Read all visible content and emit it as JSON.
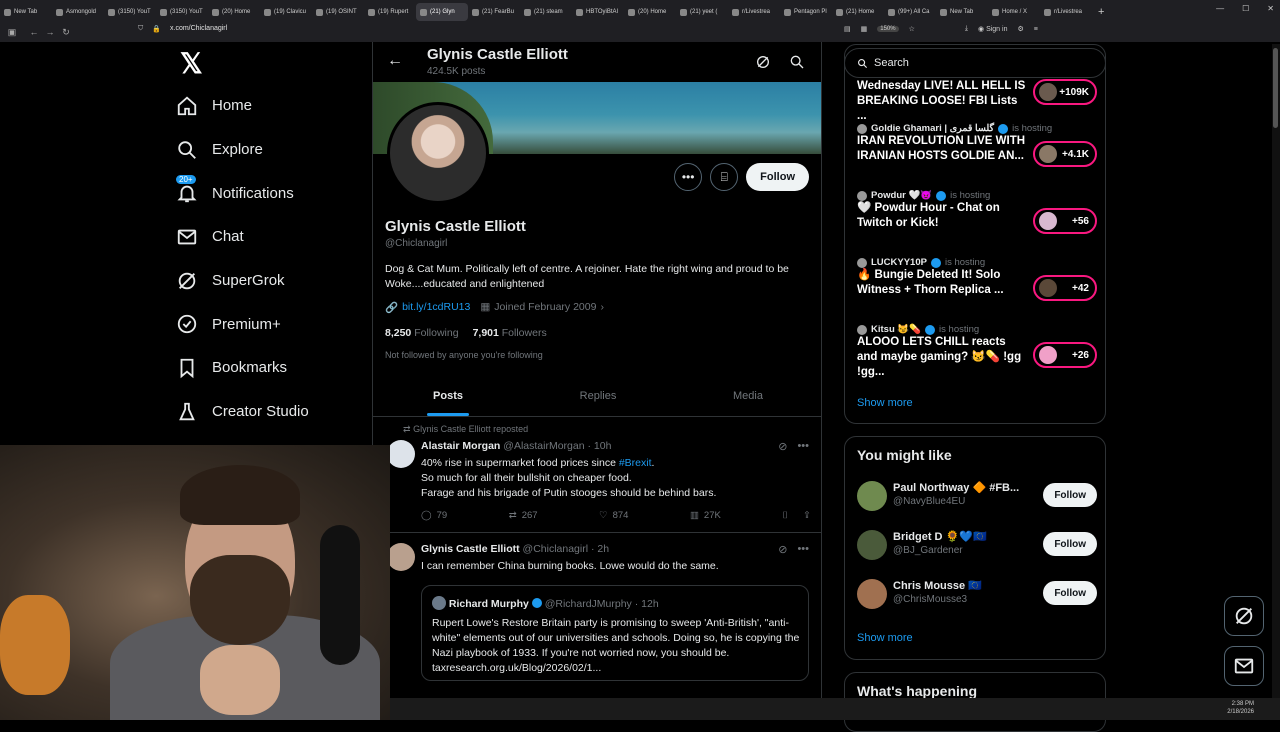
{
  "browser": {
    "tabs": [
      {
        "label": "New Tab",
        "active": false
      },
      {
        "label": "Asmongold",
        "active": false
      },
      {
        "label": "(3150) YouT",
        "active": false
      },
      {
        "label": "(3150) YouT",
        "active": false
      },
      {
        "label": "(20) Home",
        "active": false
      },
      {
        "label": "(19) Clavicu",
        "active": false
      },
      {
        "label": "(19) OSINT",
        "active": false
      },
      {
        "label": "(19) Rupert",
        "active": false
      },
      {
        "label": "(21) Glyn",
        "active": true
      },
      {
        "label": "(21) FearBu",
        "active": false
      },
      {
        "label": "(21) steam",
        "active": false
      },
      {
        "label": "HBTOyiBtAl",
        "active": false
      },
      {
        "label": "(20) Home",
        "active": false
      },
      {
        "label": "(21) yeet (",
        "active": false
      },
      {
        "label": "r/Livestrea",
        "active": false
      },
      {
        "label": "Pentagon Pl",
        "active": false
      },
      {
        "label": "(21) Home",
        "active": false
      },
      {
        "label": "(99+) All Ca",
        "active": false
      },
      {
        "label": "New Tab",
        "active": false
      },
      {
        "label": "Home / X",
        "active": false
      },
      {
        "label": "r/Livestrea",
        "active": false
      }
    ],
    "url": "x.com/Chiclanagirl",
    "zoom": "150%",
    "signin": "Sign in"
  },
  "nav": {
    "items": [
      {
        "label": "Home",
        "icon": "home-icon"
      },
      {
        "label": "Explore",
        "icon": "search-icon"
      },
      {
        "label": "Notifications",
        "icon": "bell-icon",
        "badge": "20+"
      },
      {
        "label": "Chat",
        "icon": "mail-icon"
      },
      {
        "label": "SuperGrok",
        "icon": "grok-icon"
      },
      {
        "label": "Premium+",
        "icon": "verified-icon"
      },
      {
        "label": "Bookmarks",
        "icon": "bookmark-icon"
      },
      {
        "label": "Creator Studio",
        "icon": "flask-icon"
      }
    ]
  },
  "profile": {
    "header_name": "Glynis Castle Elliott",
    "header_posts": "424.5K posts",
    "name": "Glynis Castle Elliott",
    "handle": "@Chiclanagirl",
    "bio": "Dog & Cat Mum. Politically left of centre. A rejoiner. Hate the right wing and proud to be Woke....educated and enlightened",
    "link": "bit.ly/1cdRU13",
    "joined": "Joined February 2009",
    "following_count": "8,250",
    "following_label": "Following",
    "followers_count": "7,901",
    "followers_label": "Followers",
    "not_followed": "Not followed by anyone you're following",
    "follow_label": "Follow",
    "tabs": [
      "Posts",
      "Replies",
      "Media"
    ]
  },
  "tweets": [
    {
      "reposted_by": "Glynis Castle Elliott reposted",
      "name": "Alastair Morgan",
      "handle": "@AlastairMorgan",
      "time": "· 10h",
      "line1_pre": "40% rise in supermarket food prices since ",
      "line1_hash": "#Brexit",
      "line1_post": ".",
      "line2": "So much for all their bullshit on cheaper food.",
      "line3": "Farage and his brigade of Putin stooges should be behind bars.",
      "replies": "79",
      "reposts": "267",
      "likes": "874",
      "views": "27K"
    },
    {
      "name": "Glynis Castle Elliott",
      "handle": "@Chiclanagirl",
      "time": "· 2h",
      "text": "I can remember China burning books. Lowe would do the same.",
      "quote": {
        "name": "Richard Murphy",
        "handle": "@RichardJMurphy",
        "time": "· 12h",
        "text": "Rupert Lowe's Restore Britain party is promising to sweep 'Anti-British', \"anti-white\" elements out of our universities and schools. Doing so, he is copying the Nazi playbook of 1933. If you're not worried now, you should be. taxresearch.org.uk/Blog/2026/02/1..."
      }
    }
  ],
  "sidebar": {
    "search_placeholder": "Search",
    "spaces": [
      {
        "host": "",
        "hosting": "",
        "title": "Wednesday LIVE! ALL HELL IS BREAKING LOOSE! FBI Lists ...",
        "count": "+109K"
      },
      {
        "host": "Goldie Ghamari | گلسا قمری",
        "hosting": "is hosting",
        "title": "IRAN REVOLUTION LIVE WITH IRANIAN HOSTS GOLDIE AN...",
        "count": "+4.1K"
      },
      {
        "host": "Powdur 🤍😈",
        "hosting": "is hosting",
        "title": "🤍 Powdur Hour - Chat on Twitch or Kick!",
        "count": "+56"
      },
      {
        "host": "LUCKYY10P",
        "hosting": "is hosting",
        "title": "🔥 Bungie Deleted It! Solo Witness + Thorn Replica ...",
        "count": "+42"
      },
      {
        "host": "Kitsu 😼💊",
        "hosting": "is hosting",
        "title": "ALOOO LETS CHILL reacts and maybe gaming? 😼💊 !gg !gg...",
        "count": "+26"
      }
    ],
    "show_more": "Show more",
    "might_like_title": "You might like",
    "suggestions": [
      {
        "name": "Paul Northway 🔶 #FB...",
        "handle": "@NavyBlue4EU",
        "follow": "Follow"
      },
      {
        "name": "Bridget D 🌻💙🇪🇺",
        "handle": "@BJ_Gardener",
        "follow": "Follow"
      },
      {
        "name": "Chris Mousse 🇪🇺",
        "handle": "@ChrisMousse3",
        "follow": "Follow"
      }
    ],
    "show_more_2": "Show more",
    "happening_title": "What's happening"
  },
  "taskbar": {
    "time": "2:38 PM",
    "date": "2/18/2026"
  },
  "colors": {
    "accent": "#1d9bf0",
    "live": "#f91880",
    "background": "#000000"
  }
}
